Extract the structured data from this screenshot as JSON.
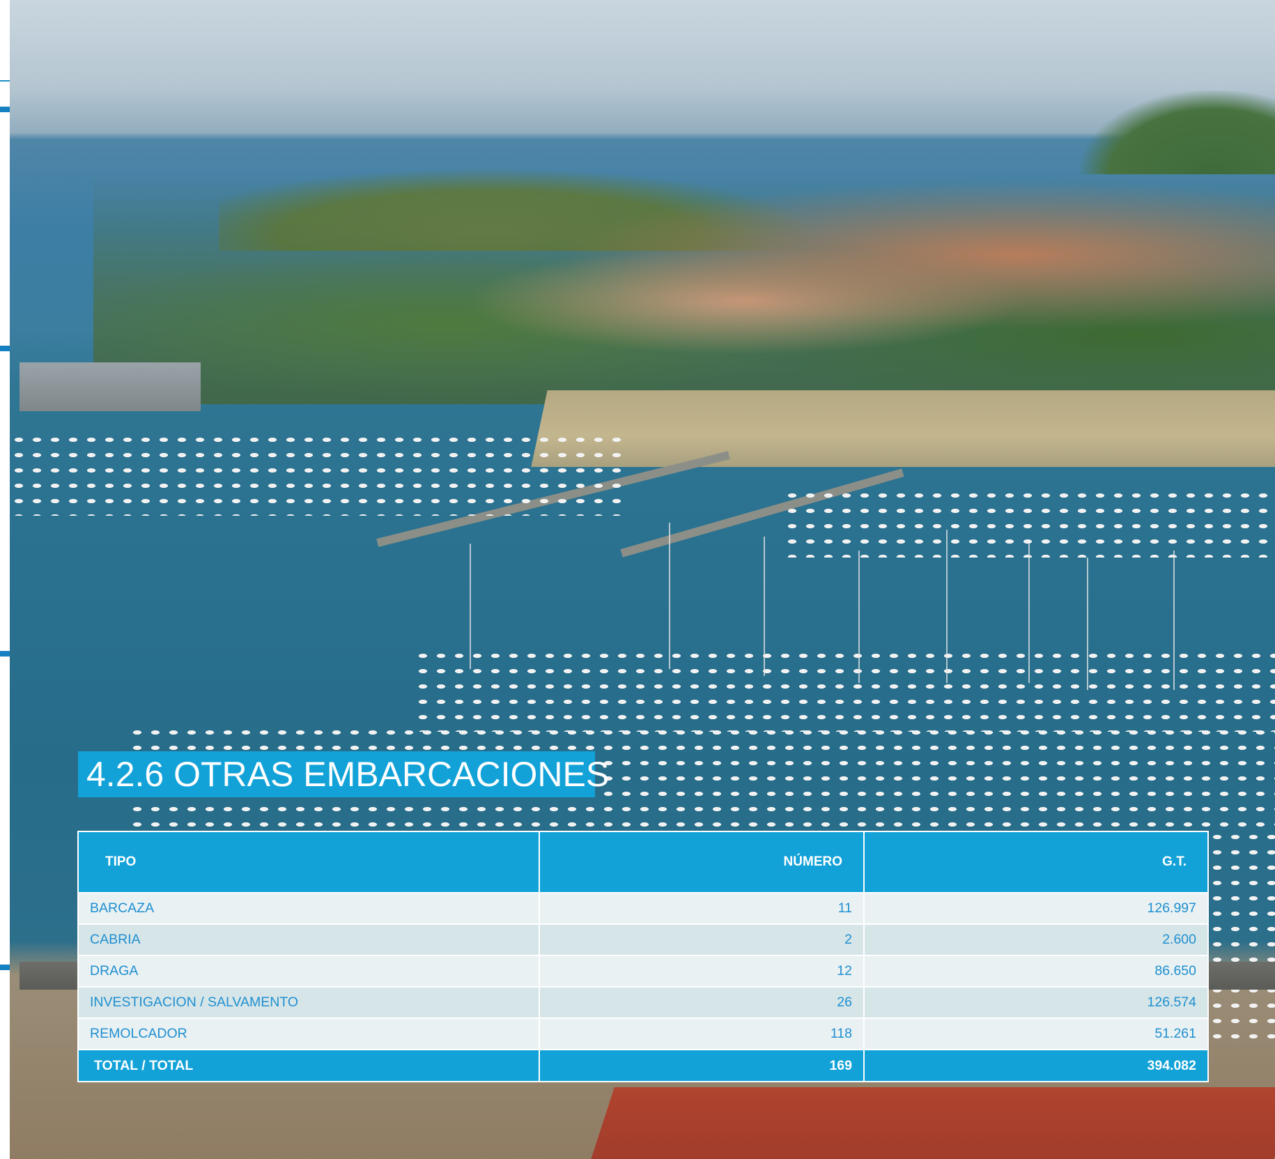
{
  "section": {
    "heading": "4.2.6 OTRAS EMBARCACIONES"
  },
  "table": {
    "headers": {
      "tipo": "TIPO",
      "numero": "NÚMERO",
      "gt": "G.T."
    },
    "rows": [
      {
        "tipo": "BARCAZA",
        "numero": "11",
        "gt": "126.997"
      },
      {
        "tipo": "CABRIA",
        "numero": "2",
        "gt": "2.600"
      },
      {
        "tipo": "DRAGA",
        "numero": "12",
        "gt": "86.650"
      },
      {
        "tipo": "INVESTIGACION / SALVAMENTO",
        "numero": "26",
        "gt": "126.574"
      },
      {
        "tipo": "REMOLCADOR",
        "numero": "118",
        "gt": "51.261"
      }
    ],
    "total": {
      "tipo": "TOTAL / TOTAL",
      "numero": "169",
      "gt": "394.082"
    }
  },
  "colors": {
    "accent": "#12a2d8",
    "row_text": "#1f8fd0",
    "row_light": "#e9f1f3",
    "row_dark": "#d6e5e8"
  },
  "background_image": "marina-harbor-photo"
}
